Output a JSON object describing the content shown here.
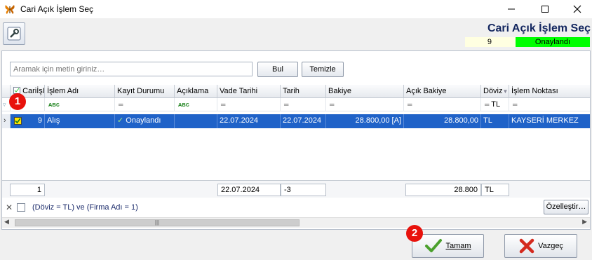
{
  "window": {
    "title": "Cari Açık İşlem Seç",
    "icons": {
      "app": "butterfly-app-icon",
      "min": "minimize-icon",
      "max": "maximize-icon",
      "close": "close-icon"
    }
  },
  "header": {
    "title": "Cari Açık İşlem Seç",
    "count": "9",
    "status": "Onaylandı",
    "status_color": "#00ff00"
  },
  "search": {
    "placeholder": "Aramak için metin giriniz…",
    "find_label": "Bul",
    "clear_label": "Temizle"
  },
  "grid": {
    "columns": [
      "CariİşI",
      "İşlem Adı",
      "Kayıt Durumu",
      "Açıklama",
      "Vade Tarihi",
      "Tarih",
      "Bakiye",
      "Açık Bakiye",
      "Döviz",
      "İşlem Noktası"
    ],
    "filter_values": {
      "doviz": "TL"
    },
    "rows": [
      {
        "id": "9",
        "islem_adi": "Alış",
        "kayit_durumu": "Onaylandı",
        "aciklama": "",
        "vade_tarihi": "22.07.2024",
        "tarih": "22.07.2024",
        "bakiye": "28.800,00 [A]",
        "acik_bakiye": "28.800,00",
        "doviz": "TL",
        "islem_noktasi": "KAYSERİ MERKEZ"
      }
    ],
    "selected_color": "#1f62c8",
    "footer": {
      "count": "1",
      "vade_tarihi": "22.07.2024",
      "tarih": "-3",
      "acik_bakiye": "28.800",
      "doviz": "TL"
    }
  },
  "filter_bar": {
    "expression": "(Döviz = TL) ve (Firma Adı = 1)",
    "customize_label": "Özelleştir…"
  },
  "actions": {
    "ok_label": "Tamam",
    "cancel_label": "Vazgeç"
  },
  "annotations": {
    "badge_1": "1",
    "badge_2": "2",
    "badge_color": "#e8120c"
  }
}
